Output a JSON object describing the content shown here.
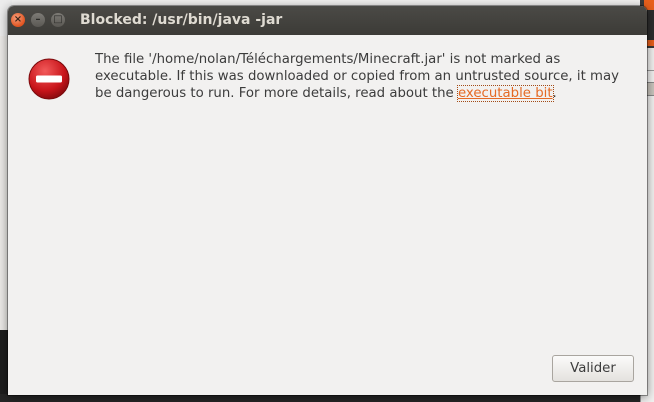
{
  "dialog": {
    "title": "Blocked: /usr/bin/java -jar",
    "window_controls": {
      "close": "×",
      "minimize": "–",
      "maximize": "□"
    },
    "message_part1": "The file '/home/nolan/Téléchargements/Minecraft.jar' is not marked as executable.  If this was downloaded or copied from an untrusted source, it may be dangerous to run.  For more details, read about the ",
    "link_text": "executable bit",
    "message_part2": ".",
    "ok_label": "Valider",
    "icon": "stop-icon"
  },
  "colors": {
    "titlebar": "#3c3b37",
    "close_button": "#e0531f",
    "link": "#e56a25",
    "background": "#f2f1f0"
  }
}
